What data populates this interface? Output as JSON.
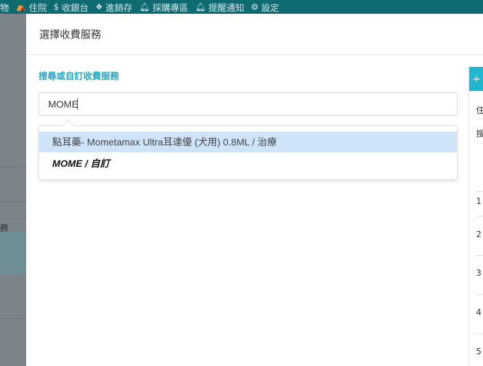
{
  "topnav": {
    "items": [
      {
        "label": "物",
        "icon": ""
      },
      {
        "label": "住院",
        "icon": "bed-icon"
      },
      {
        "label": "收銀台",
        "icon": "dollar-icon"
      },
      {
        "label": "進銷存",
        "icon": "cubes-icon"
      },
      {
        "label": "採購專區",
        "icon": "bell-icon"
      },
      {
        "label": "提醒通知",
        "icon": "bell-icon"
      },
      {
        "label": "設定",
        "icon": "gear-icon"
      }
    ]
  },
  "background": {
    "left_label": "務"
  },
  "modal": {
    "title": "選擇收費服務",
    "section_label": "搜尋或自訂收費服務",
    "search": {
      "value": "MOME"
    },
    "dropdown": {
      "options": [
        {
          "label": "點耳藥- Mometamax Ultra耳達優 (犬用) 0.8ML / 治療"
        },
        {
          "label": "MOME / 自訂"
        }
      ]
    }
  },
  "right_panel": {
    "button_label": "+",
    "texts": [
      "住",
      "搜",
      "1",
      "2",
      "3",
      "4",
      "5"
    ]
  }
}
